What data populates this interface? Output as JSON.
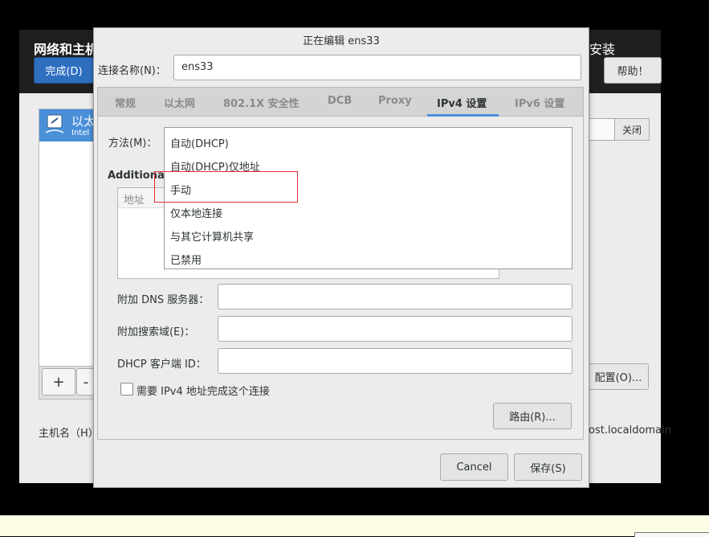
{
  "background_window": {
    "title": "网络和主机",
    "title_right": "安装",
    "done_button": "完成(D)",
    "help_button": "帮助！",
    "network_item_title": "以太",
    "network_item_subtitle": "Intel",
    "add_button": "+",
    "remove_button": "-",
    "switch_label": "关闭",
    "configure_button": "配置(O)...",
    "hostname_label": "主机名（H）",
    "hostname_value": "ost.localdomain"
  },
  "dialog": {
    "title": "正在编辑 ens33",
    "connection_name_label": "连接名称(N)：",
    "connection_name_value": "ens33",
    "tabs": [
      {
        "label": "常规",
        "active": false
      },
      {
        "label": "以太网",
        "active": false
      },
      {
        "label": "802.1X 安全性",
        "active": false
      },
      {
        "label": "DCB",
        "active": false
      },
      {
        "label": "Proxy",
        "active": false
      },
      {
        "label": "IPv4 设置",
        "active": true
      },
      {
        "label": "IPv6 设置",
        "active": false
      }
    ],
    "method_label": "方法(M)：",
    "method_options": [
      "自动(DHCP)",
      "自动(DHCP)仅地址",
      "手动",
      "仅本地连接",
      "与其它计算机共享",
      "已禁用"
    ],
    "highlighted_option": "手动",
    "additional_label": "Additiona",
    "address_column": "地址",
    "dns_label": "附加 DNS 服务器：",
    "dns_value": "",
    "search_domain_label": "附加搜索域(E)：",
    "search_domain_value": "",
    "dhcp_client_id_label": "DHCP 客户端 ID：",
    "dhcp_client_id_value": "",
    "require_ipv4_label": "需要 IPv4 地址完成这个连接",
    "require_ipv4_checked": false,
    "routes_button": "路由(R)...",
    "cancel_button": "Cancel",
    "save_button": "保存(S)"
  },
  "colors": {
    "accent": "#4a90d9",
    "highlight_border": "#e03030",
    "done_button": "#2e6fc0"
  }
}
